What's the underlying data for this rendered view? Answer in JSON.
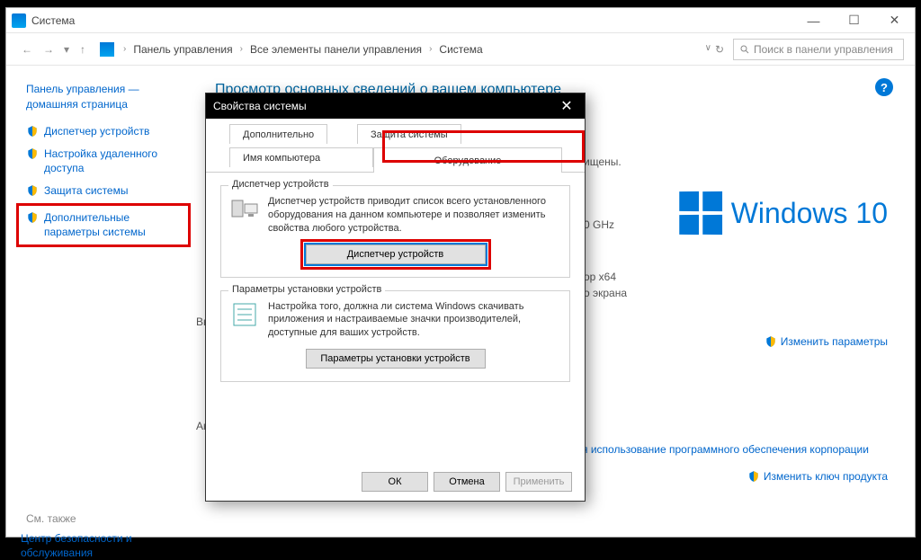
{
  "window": {
    "title": "Система"
  },
  "breadcrumb": [
    "Панель управления",
    "Все элементы панели управления",
    "Система"
  ],
  "search_placeholder": "Поиск в панели управления",
  "sidebar": {
    "home_lines": [
      "Панель управления —",
      "домашняя страница"
    ],
    "items": [
      {
        "label": "Диспетчер устройств"
      },
      {
        "label": "Настройка удаленного доступа"
      },
      {
        "label": "Защита системы"
      },
      {
        "label": "Дополнительные параметры системы"
      }
    ],
    "see_also_label": "См. также",
    "see_also_link": "Центр безопасности и обслуживания"
  },
  "content": {
    "heading": "Просмотр основных сведений о вашем компьютере",
    "windows_brand": "Windows 10",
    "snippets": {
      "secured": "ищены.",
      "ghz": "0 GHz",
      "arch": "ор x64",
      "screen": "о экрана",
      "vyp": "Вы",
      "ak": "Ак",
      "change_settings": "Изменить параметры",
      "license_link": "я использование программного обеспечения корпорации",
      "change_key": "Изменить ключ продукта"
    }
  },
  "dialog": {
    "title": "Свойства системы",
    "tabs": {
      "row1": [
        "Дополнительно",
        "Защита системы"
      ],
      "row2": [
        "Имя компьютера",
        "Оборудование"
      ]
    },
    "group1": {
      "title": "Диспетчер устройств",
      "text": "Диспетчер устройств приводит список всего установленного оборудования на данном компьютере и позволяет изменить свойства любого устройства.",
      "button": "Диспетчер устройств"
    },
    "group2": {
      "title": "Параметры установки устройств",
      "text": "Настройка того, должна ли система Windows скачивать приложения и настраиваемые значки производителей, доступные для ваших устройств.",
      "button": "Параметры установки устройств"
    },
    "buttons": {
      "ok": "ОК",
      "cancel": "Отмена",
      "apply": "Применить"
    }
  }
}
